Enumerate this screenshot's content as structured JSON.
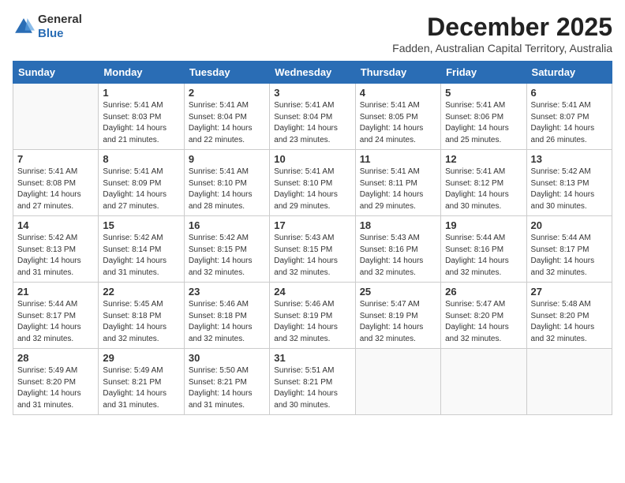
{
  "logo": {
    "general": "General",
    "blue": "Blue"
  },
  "header": {
    "title": "December 2025",
    "subtitle": "Fadden, Australian Capital Territory, Australia"
  },
  "weekdays": [
    "Sunday",
    "Monday",
    "Tuesday",
    "Wednesday",
    "Thursday",
    "Friday",
    "Saturday"
  ],
  "weeks": [
    [
      {
        "day": "",
        "sunrise": "",
        "sunset": "",
        "daylight": ""
      },
      {
        "day": "1",
        "sunrise": "Sunrise: 5:41 AM",
        "sunset": "Sunset: 8:03 PM",
        "daylight": "Daylight: 14 hours and 21 minutes."
      },
      {
        "day": "2",
        "sunrise": "Sunrise: 5:41 AM",
        "sunset": "Sunset: 8:04 PM",
        "daylight": "Daylight: 14 hours and 22 minutes."
      },
      {
        "day": "3",
        "sunrise": "Sunrise: 5:41 AM",
        "sunset": "Sunset: 8:04 PM",
        "daylight": "Daylight: 14 hours and 23 minutes."
      },
      {
        "day": "4",
        "sunrise": "Sunrise: 5:41 AM",
        "sunset": "Sunset: 8:05 PM",
        "daylight": "Daylight: 14 hours and 24 minutes."
      },
      {
        "day": "5",
        "sunrise": "Sunrise: 5:41 AM",
        "sunset": "Sunset: 8:06 PM",
        "daylight": "Daylight: 14 hours and 25 minutes."
      },
      {
        "day": "6",
        "sunrise": "Sunrise: 5:41 AM",
        "sunset": "Sunset: 8:07 PM",
        "daylight": "Daylight: 14 hours and 26 minutes."
      }
    ],
    [
      {
        "day": "7",
        "sunrise": "Sunrise: 5:41 AM",
        "sunset": "Sunset: 8:08 PM",
        "daylight": "Daylight: 14 hours and 27 minutes."
      },
      {
        "day": "8",
        "sunrise": "Sunrise: 5:41 AM",
        "sunset": "Sunset: 8:09 PM",
        "daylight": "Daylight: 14 hours and 27 minutes."
      },
      {
        "day": "9",
        "sunrise": "Sunrise: 5:41 AM",
        "sunset": "Sunset: 8:10 PM",
        "daylight": "Daylight: 14 hours and 28 minutes."
      },
      {
        "day": "10",
        "sunrise": "Sunrise: 5:41 AM",
        "sunset": "Sunset: 8:10 PM",
        "daylight": "Daylight: 14 hours and 29 minutes."
      },
      {
        "day": "11",
        "sunrise": "Sunrise: 5:41 AM",
        "sunset": "Sunset: 8:11 PM",
        "daylight": "Daylight: 14 hours and 29 minutes."
      },
      {
        "day": "12",
        "sunrise": "Sunrise: 5:41 AM",
        "sunset": "Sunset: 8:12 PM",
        "daylight": "Daylight: 14 hours and 30 minutes."
      },
      {
        "day": "13",
        "sunrise": "Sunrise: 5:42 AM",
        "sunset": "Sunset: 8:13 PM",
        "daylight": "Daylight: 14 hours and 30 minutes."
      }
    ],
    [
      {
        "day": "14",
        "sunrise": "Sunrise: 5:42 AM",
        "sunset": "Sunset: 8:13 PM",
        "daylight": "Daylight: 14 hours and 31 minutes."
      },
      {
        "day": "15",
        "sunrise": "Sunrise: 5:42 AM",
        "sunset": "Sunset: 8:14 PM",
        "daylight": "Daylight: 14 hours and 31 minutes."
      },
      {
        "day": "16",
        "sunrise": "Sunrise: 5:42 AM",
        "sunset": "Sunset: 8:15 PM",
        "daylight": "Daylight: 14 hours and 32 minutes."
      },
      {
        "day": "17",
        "sunrise": "Sunrise: 5:43 AM",
        "sunset": "Sunset: 8:15 PM",
        "daylight": "Daylight: 14 hours and 32 minutes."
      },
      {
        "day": "18",
        "sunrise": "Sunrise: 5:43 AM",
        "sunset": "Sunset: 8:16 PM",
        "daylight": "Daylight: 14 hours and 32 minutes."
      },
      {
        "day": "19",
        "sunrise": "Sunrise: 5:44 AM",
        "sunset": "Sunset: 8:16 PM",
        "daylight": "Daylight: 14 hours and 32 minutes."
      },
      {
        "day": "20",
        "sunrise": "Sunrise: 5:44 AM",
        "sunset": "Sunset: 8:17 PM",
        "daylight": "Daylight: 14 hours and 32 minutes."
      }
    ],
    [
      {
        "day": "21",
        "sunrise": "Sunrise: 5:44 AM",
        "sunset": "Sunset: 8:17 PM",
        "daylight": "Daylight: 14 hours and 32 minutes."
      },
      {
        "day": "22",
        "sunrise": "Sunrise: 5:45 AM",
        "sunset": "Sunset: 8:18 PM",
        "daylight": "Daylight: 14 hours and 32 minutes."
      },
      {
        "day": "23",
        "sunrise": "Sunrise: 5:46 AM",
        "sunset": "Sunset: 8:18 PM",
        "daylight": "Daylight: 14 hours and 32 minutes."
      },
      {
        "day": "24",
        "sunrise": "Sunrise: 5:46 AM",
        "sunset": "Sunset: 8:19 PM",
        "daylight": "Daylight: 14 hours and 32 minutes."
      },
      {
        "day": "25",
        "sunrise": "Sunrise: 5:47 AM",
        "sunset": "Sunset: 8:19 PM",
        "daylight": "Daylight: 14 hours and 32 minutes."
      },
      {
        "day": "26",
        "sunrise": "Sunrise: 5:47 AM",
        "sunset": "Sunset: 8:20 PM",
        "daylight": "Daylight: 14 hours and 32 minutes."
      },
      {
        "day": "27",
        "sunrise": "Sunrise: 5:48 AM",
        "sunset": "Sunset: 8:20 PM",
        "daylight": "Daylight: 14 hours and 32 minutes."
      }
    ],
    [
      {
        "day": "28",
        "sunrise": "Sunrise: 5:49 AM",
        "sunset": "Sunset: 8:20 PM",
        "daylight": "Daylight: 14 hours and 31 minutes."
      },
      {
        "day": "29",
        "sunrise": "Sunrise: 5:49 AM",
        "sunset": "Sunset: 8:21 PM",
        "daylight": "Daylight: 14 hours and 31 minutes."
      },
      {
        "day": "30",
        "sunrise": "Sunrise: 5:50 AM",
        "sunset": "Sunset: 8:21 PM",
        "daylight": "Daylight: 14 hours and 31 minutes."
      },
      {
        "day": "31",
        "sunrise": "Sunrise: 5:51 AM",
        "sunset": "Sunset: 8:21 PM",
        "daylight": "Daylight: 14 hours and 30 minutes."
      },
      {
        "day": "",
        "sunrise": "",
        "sunset": "",
        "daylight": ""
      },
      {
        "day": "",
        "sunrise": "",
        "sunset": "",
        "daylight": ""
      },
      {
        "day": "",
        "sunrise": "",
        "sunset": "",
        "daylight": ""
      }
    ]
  ],
  "accent_color": "#2a6db5"
}
